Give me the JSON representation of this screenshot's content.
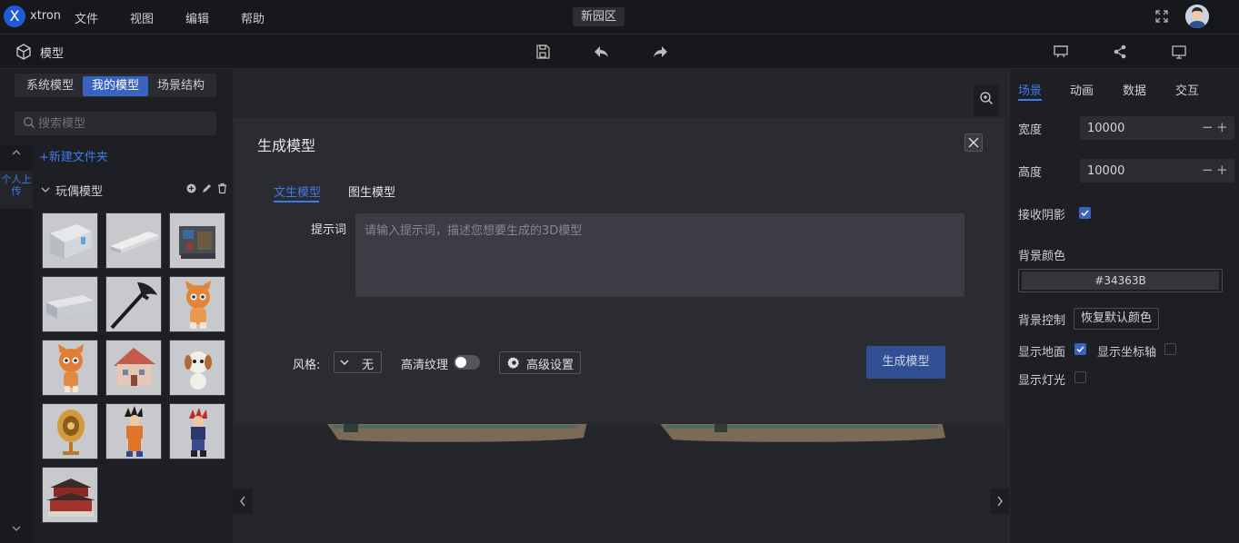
{
  "app": {
    "logo_letter": "X",
    "brand": "xtron",
    "project_name": "新园区"
  },
  "menu": [
    "文件",
    "视图",
    "编辑",
    "帮助"
  ],
  "toolbar": {
    "title": "模型"
  },
  "left_panel": {
    "tabs": [
      "系统模型",
      "我的模型",
      "场景结构"
    ],
    "active_tab": "我的模型",
    "search_placeholder": "搜索模型",
    "new_folder": "+新建文件夹",
    "strip_personal": "个人上传",
    "folder_name": "玩偶模型",
    "thumbnails": [
      "building",
      "long-hall",
      "machine",
      "wall",
      "axe",
      "cat-1",
      "cat-2",
      "house",
      "dog",
      "medal",
      "goku",
      "figure",
      "palace"
    ]
  },
  "right_panel": {
    "tabs": [
      "场景",
      "动画",
      "数据",
      "交互"
    ],
    "active_tab": "场景",
    "width_label": "宽度",
    "width_value": "10000",
    "height_label": "高度",
    "height_value": "10000",
    "minus": "−",
    "plus": "+",
    "receive_shadow_label": "接收阴影",
    "receive_shadow_checked": true,
    "bg_color_label": "背景颜色",
    "bg_color_value": "#34363B",
    "bg_control_label": "背景控制",
    "reset_color_button": "恢复默认颜色",
    "show_ground_label": "显示地面",
    "show_ground_checked": true,
    "show_axis_label": "显示坐标轴",
    "show_axis_checked": false,
    "show_light_label": "显示灯光",
    "show_light_checked": false
  },
  "modal": {
    "title": "生成模型",
    "tabs": [
      "文生模型",
      "图生模型"
    ],
    "active_tab": "文生模型",
    "prompt_label": "提示词",
    "prompt_placeholder": "请输入提示词，描述您想要生成的3D模型",
    "style_label": "风格:",
    "style_value": "无",
    "hd_texture_label": "高清纹理",
    "hd_texture_on": false,
    "advanced_button": "高级设置",
    "generate_button": "生成模型"
  },
  "colors": {
    "accent": "#3e7ae6",
    "active_tab_bg": "#3a63bf",
    "generate_bg": "#334f93"
  }
}
